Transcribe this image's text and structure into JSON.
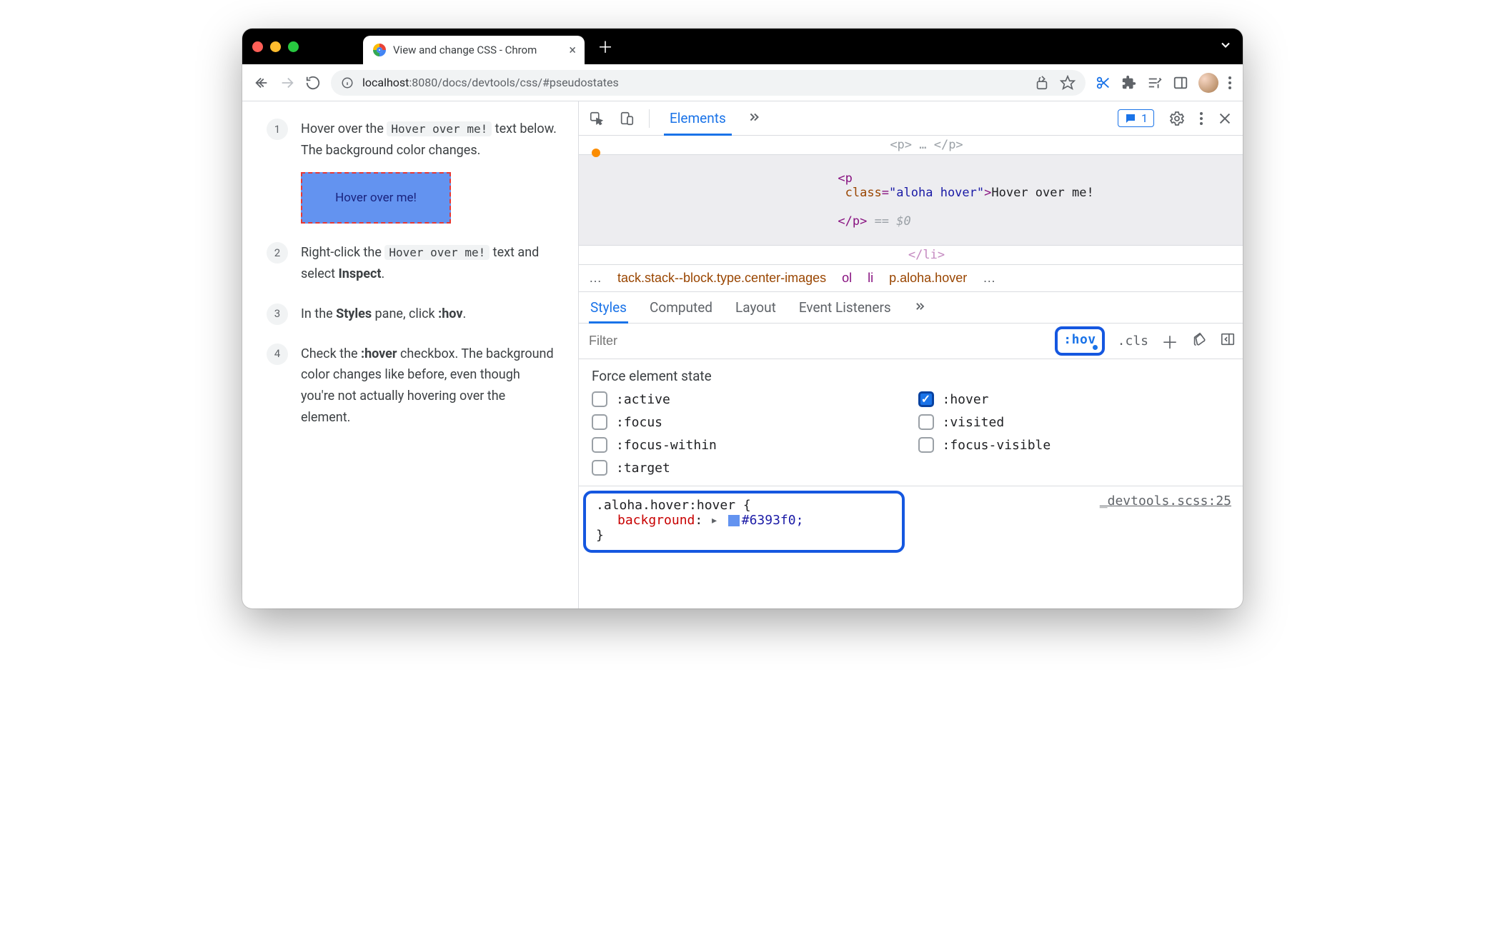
{
  "window": {
    "tab_title": "View and change CSS - Chrom",
    "traffic_colors": {
      "close": "#ff5f57",
      "min": "#febc2e",
      "max": "#28c840"
    }
  },
  "url": {
    "scheme_icon": "info",
    "host": "localhost",
    "port": ":8080",
    "path": "/docs/devtools/css/#pseudostates"
  },
  "steps": [
    {
      "num": "1",
      "prefix": "Hover over the ",
      "code": "Hover over me!",
      "suffix": " text below. The background color changes.",
      "demo_label": "Hover over me!"
    },
    {
      "num": "2",
      "prefix": "Right-click the ",
      "code": "Hover over me!",
      "mid": " text and select ",
      "bold": "Inspect",
      "suffix": "."
    },
    {
      "num": "3",
      "prefix": "In the ",
      "bold": "Styles",
      "mid": " pane, click ",
      "bold2": ":hov",
      "suffix": "."
    },
    {
      "num": "4",
      "prefix": "Check the ",
      "bold": ":hover",
      "suffix": " checkbox. The background color changes like before, even though you're not actually hovering over the element."
    }
  ],
  "devtools": {
    "top_tab": "Elements",
    "messages_count": "1",
    "dom": {
      "prev_frag": "…",
      "line_open_tag": "p",
      "line_attr_name": "class",
      "line_attr_val": "aloha hover",
      "line_text": "Hover over me!",
      "line_close": "</p>",
      "eq0": "== $0",
      "after": "</li>"
    },
    "breadcrumbs": {
      "left_dots": "…",
      "crumbs": [
        "tack.stack--block.type.center-images",
        "ol",
        "li",
        "p.aloha.hover"
      ],
      "right_dots": "…"
    },
    "subtabs": [
      "Styles",
      "Computed",
      "Layout",
      "Event Listeners"
    ],
    "filter_placeholder": "Filter",
    "filter_tools": {
      "hov": ":hov",
      "cls": ".cls",
      "plus": "+",
      "brush": "brush",
      "panel": "panel"
    },
    "force_state": {
      "title": "Force element state",
      "states": [
        {
          "label": ":active",
          "checked": false
        },
        {
          "label": ":hover",
          "checked": true
        },
        {
          "label": ":focus",
          "checked": false
        },
        {
          "label": ":visited",
          "checked": false
        },
        {
          "label": ":focus-within",
          "checked": false
        },
        {
          "label": ":focus-visible",
          "checked": false
        },
        {
          "label": ":target",
          "checked": false
        }
      ]
    },
    "rule": {
      "selector": ".aloha.hover:hover",
      "brace_open": " {",
      "prop_name": "background",
      "prop_arrow": "▸",
      "swatch_color": "#6393f0",
      "prop_value": "#6393f0;",
      "brace_close": "}",
      "source": "_devtools.scss:25"
    }
  }
}
